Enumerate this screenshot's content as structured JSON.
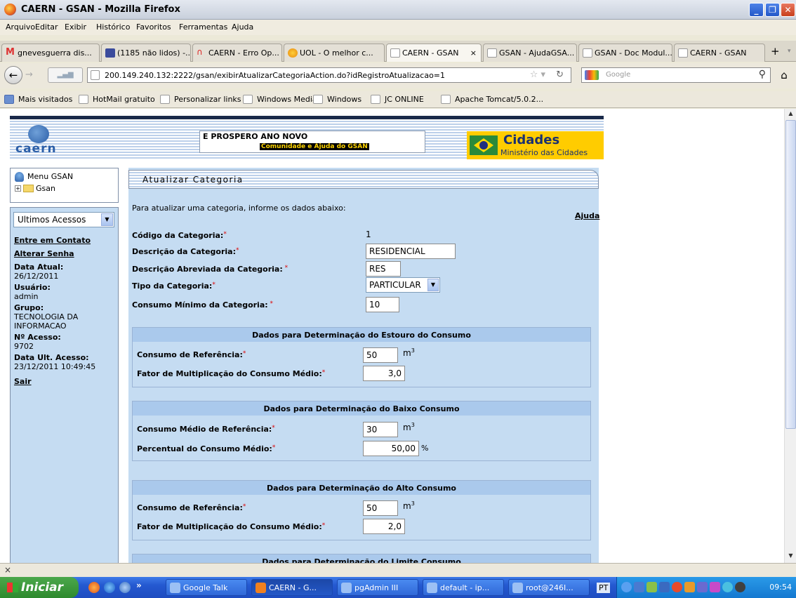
{
  "window": {
    "title": "CAERN - GSAN - Mozilla Firefox"
  },
  "menu": [
    "Arquivo",
    "Editar",
    "Exibir",
    "Histórico",
    "Favoritos",
    "Ferramentas",
    "Ajuda"
  ],
  "tabs": [
    "gnevesguerra dis...",
    "(1185 não lidos) -...",
    "CAERN - Erro Op...",
    "UOL - O melhor c...",
    "CAERN - GSAN",
    "GSAN - AjudaGSA...",
    "GSAN - Doc Modul...",
    "CAERN - GSAN"
  ],
  "nav": {
    "url": "200.149.240.132:2222/gsan/exibirAtualizarCategoriaAction.do?idRegistroAtualizacao=1",
    "search_placeholder": "Google"
  },
  "bookmarks": [
    "Mais visitados",
    "HotMail gratuito",
    "Personalizar links",
    "Windows Media",
    "Windows",
    "JC ONLINE",
    "Apache Tomcat/5.0.2..."
  ],
  "header": {
    "logo_text": "caern",
    "message_line1": "E PROSPERO ANO NOVO",
    "message_line2": "Comunidade e Ajuda do GSAN",
    "cidades_title": "Cidades",
    "cidades_sub": "Ministério das Cidades"
  },
  "sidebar": {
    "menu_label": "Menu GSAN",
    "tree_root": "Gsan",
    "ultimos_acessos": "Ultimos Acessos",
    "links": [
      "Entre em Contato",
      "Alterar Senha"
    ],
    "data_atual_label": "Data Atual:",
    "data_atual": "26/12/2011",
    "usuario_label": "Usuário:",
    "usuario": "admin",
    "grupo_label": "Grupo:",
    "grupo": "TECNOLOGIA DA INFORMACAO",
    "acesso_label": "Nº Acesso:",
    "acesso": "9702",
    "ult_acesso_label": "Data Ult. Acesso:",
    "ult_acesso": "23/12/2011 10:49:45",
    "sair": "Sair"
  },
  "main": {
    "title": "Atualizar Categoria",
    "intro": "Para atualizar uma categoria, informe os dados abaixo:",
    "ajuda": "Ajuda",
    "codigo_label": "Código da Categoria:",
    "codigo": "1",
    "descricao_label": "Descrição da Categoria:",
    "descricao": "RESIDENCIAL",
    "abreviada_label": "Descrição Abreviada da Categoria:",
    "abreviada": "RES",
    "tipo_label": "Tipo da Categoria:",
    "tipo": "PARTICULAR",
    "minimo_label": "Consumo Mínimo da Categoria:",
    "minimo": "10",
    "estouro": {
      "title": "Dados para Determinação do Estouro do Consumo",
      "ref_label": "Consumo de Referência:",
      "ref": "50",
      "ref_unit": "m",
      "fator_label": "Fator de Multiplicação do Consumo Médio:",
      "fator": "3,0"
    },
    "baixo": {
      "title": "Dados para Determinação do Baixo Consumo",
      "ref_label": "Consumo Médio de Referência:",
      "ref": "30",
      "ref_unit": "m",
      "perc_label": "Percentual do Consumo Médio:",
      "perc": "50,00",
      "perc_unit": "%"
    },
    "alto": {
      "title": "Dados para Determinação do Alto Consumo",
      "ref_label": "Consumo de Referência:",
      "ref": "50",
      "ref_unit": "m",
      "fator_label": "Fator de Multiplicação do Consumo Médio:",
      "fator": "2,0"
    },
    "limite": {
      "title": "Dados para Determinação do Limite Consumo"
    }
  },
  "taskbar": {
    "start": "Iniciar",
    "tasks": [
      "Google Talk",
      "CAERN - G...",
      "pgAdmin III",
      "default - ip...",
      "root@246I..."
    ],
    "lang": "PT",
    "clock": "09:54"
  },
  "findbar_close": "×"
}
